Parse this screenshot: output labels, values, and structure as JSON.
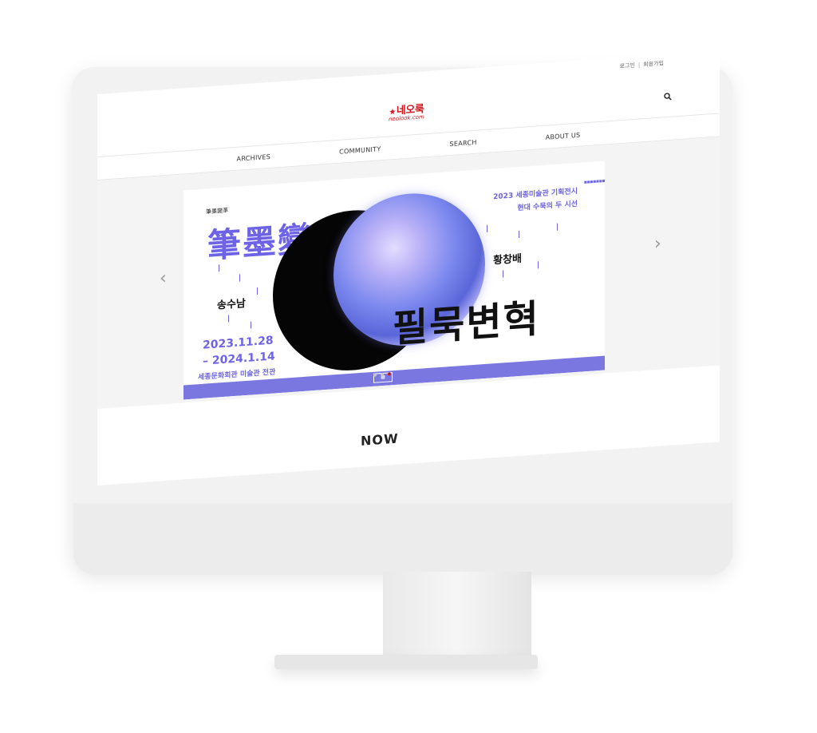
{
  "topbar": {
    "login": "로그인",
    "signup": "회원가입"
  },
  "logo": {
    "korean": "네오룩",
    "english": "neolook.com"
  },
  "nav": {
    "items": [
      "ARCHIVES",
      "COMMUNITY",
      "SEARCH",
      "ABOUT US"
    ]
  },
  "banner": {
    "hanja_label": "筆墨變革",
    "hanja": "筆墨變革",
    "title_line1": "2023 세종미술관 기획전시",
    "title_line2": "현대 수묵의 두 시선",
    "artist_left": "송수남",
    "artist_right": "황창배",
    "date_line1": "2023.11.28",
    "date_line2": "– 2024.1.14",
    "venue": "세종문화회관 미술관 전관",
    "big_title": "필묵변혁",
    "colors": {
      "accent": "#6d63e6",
      "bar": "#7b77e0"
    }
  },
  "carousel": {
    "slides": 3,
    "active_slide": 3
  },
  "section": {
    "now_label": "NOW"
  },
  "colors": {
    "brand": "#d0161c",
    "dot_active": "#c0201a"
  }
}
